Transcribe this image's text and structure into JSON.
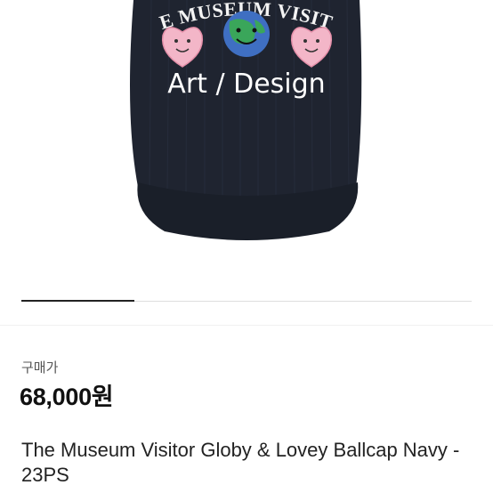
{
  "product": {
    "image_alt": "The Museum Visitor Globy & Lovey Ballcap Navy",
    "cap_text_top": "THE MUSEUM VISITOR",
    "cap_text_art": "Art / Design",
    "cap_color": "#1f2430"
  },
  "gallery": {
    "progress": 0.25,
    "indicator_color": "#222222"
  },
  "listing": {
    "status_label": "구매가",
    "price": "68,000원",
    "title": "The Museum Visitor Globy & Lovey Ballcap Navy - 23PS"
  }
}
